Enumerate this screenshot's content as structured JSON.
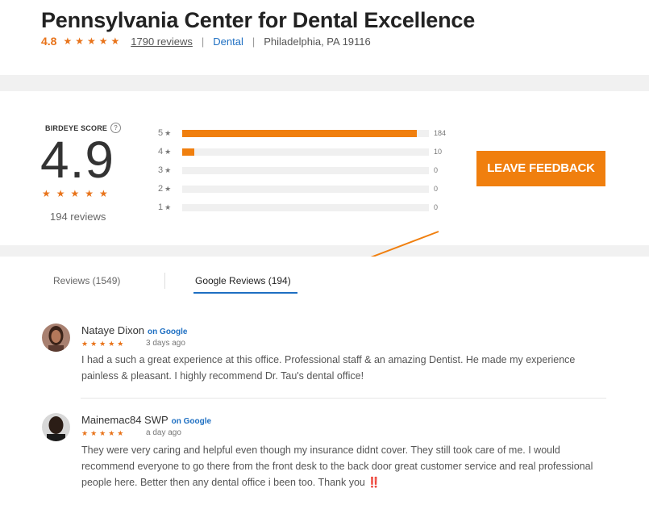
{
  "business": {
    "name": "Pennsylvania Center for Dental Excellence",
    "rating": "4.8",
    "stars": "★★★★★",
    "review_count": "1790 reviews",
    "separator": "|",
    "category": "Dental",
    "location": "Philadelphia, PA 19116"
  },
  "summary": {
    "label": "BIRDEYE SCORE",
    "help_icon": "?",
    "score": "4.9",
    "stars": "★★★★★",
    "total": "194 reviews",
    "distribution": [
      {
        "label": "5",
        "count": "184",
        "fraction": 0.95
      },
      {
        "label": "4",
        "count": "10",
        "fraction": 0.05
      },
      {
        "label": "3",
        "count": "0",
        "fraction": 0
      },
      {
        "label": "2",
        "count": "0",
        "fraction": 0
      },
      {
        "label": "1",
        "count": "0",
        "fraction": 0
      }
    ],
    "star_glyph": "★",
    "leave_feedback": "LEAVE FEEDBACK"
  },
  "tabs": {
    "reviews": "Reviews  (1549)",
    "google": "Google Reviews  (194)"
  },
  "colors": {
    "accent": "#f07f0e",
    "link": "#1e6fc2"
  },
  "reviews": [
    {
      "name": "Nataye Dixon",
      "source": "on Google",
      "stars": "★★★★★",
      "time": "3 days ago",
      "text": "I had a such a great experience at this office. Professional staff & an amazing Dentist. He made my experience painless & pleasant. I highly recommend Dr. Tau's dental office!"
    },
    {
      "name": "Mainemac84 SWP",
      "source": "on Google",
      "stars": "★★★★★",
      "time": "a day ago",
      "text": "They were very caring and helpful even though my insurance didnt cover. They still took care of me. I would recommend everyone to go there from the front desk to the back door great customer service and real professional people here. Better then any dental office i been too. Thank you ‼️"
    }
  ]
}
